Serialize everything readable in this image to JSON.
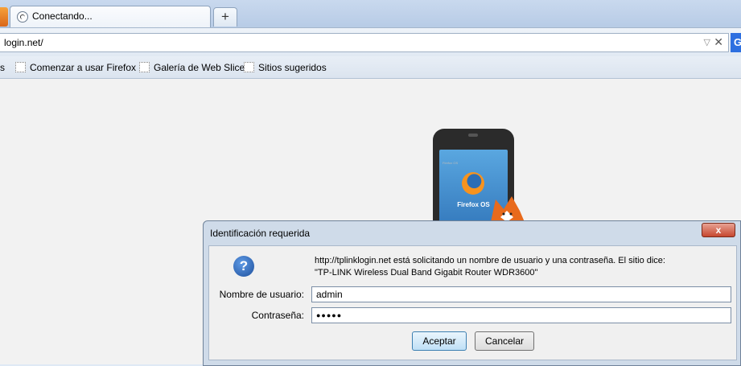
{
  "tab": {
    "title": "Conectando..."
  },
  "newtab": {
    "label": "+"
  },
  "navbar": {
    "url": "login.net/",
    "dropdown": "▽",
    "stop": "✕",
    "search_engine_glyph": "G"
  },
  "bookmarks": [
    {
      "label": "s",
      "icon": "bookmark-folder-icon"
    },
    {
      "label": "Comenzar a usar Firefox",
      "icon": "bookmark-page-icon"
    },
    {
      "label": "Galería de Web Slice",
      "icon": "bookmark-page-icon"
    },
    {
      "label": "Sitios sugeridos",
      "icon": "bookmark-page-icon"
    }
  ],
  "page": {
    "phone_brand": "Firefox OS",
    "phone_top": "Firefox OS"
  },
  "dialog": {
    "title": "Identificación requerida",
    "close_label": "x",
    "help_glyph": "?",
    "message_line1": "http://tplinklogin.net está solicitando un nombre de usuario y una contraseña. El sitio dice:",
    "message_line2": "\"TP-LINK Wireless Dual Band Gigabit Router WDR3600\"",
    "username_label": "Nombre de usuario:",
    "username_value": "admin",
    "password_label": "Contraseña:",
    "password_value": "●●●●●",
    "ok_label": "Aceptar",
    "cancel_label": "Cancelar"
  },
  "colors": {
    "accent": "#2d6fe0",
    "dialog_frame": "#cfdbe9",
    "close_button": "#c6472f"
  }
}
